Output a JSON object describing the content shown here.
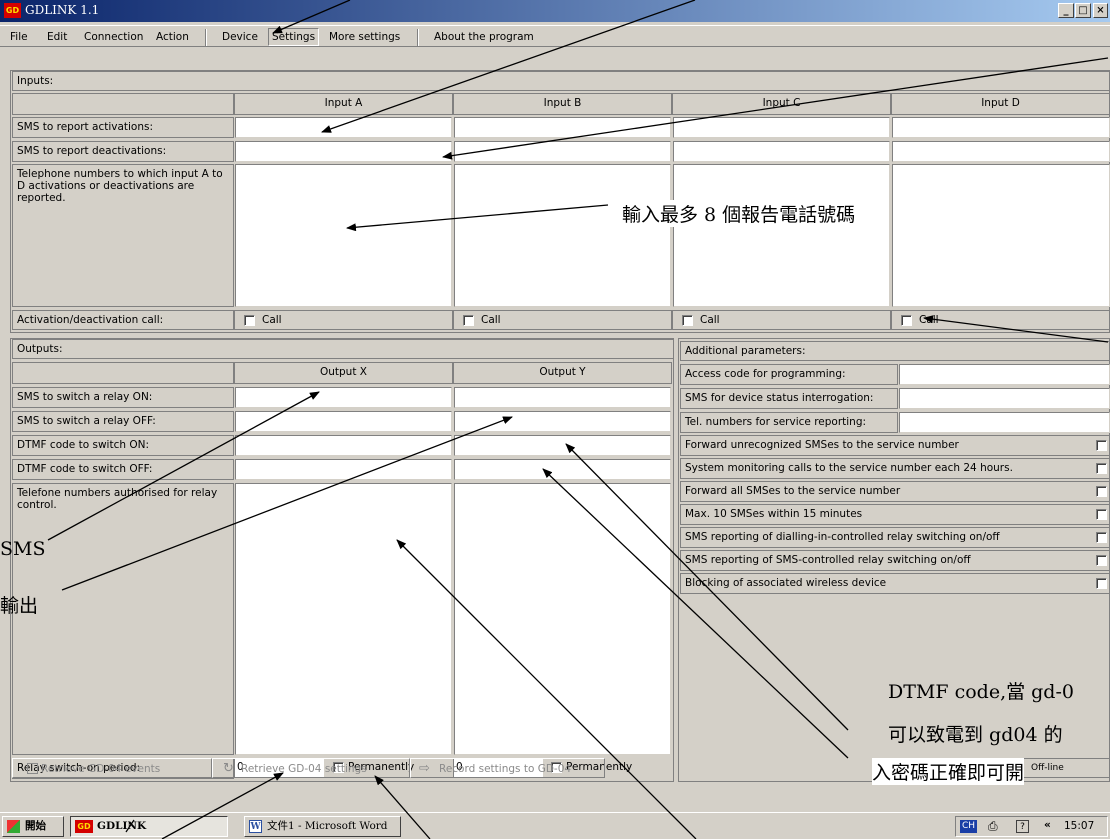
{
  "window": {
    "title": "GDLINK 1.1",
    "min": "_",
    "max": "□",
    "close": "×",
    "icon": "GD"
  },
  "menu": [
    "File",
    "Edit",
    "Connection",
    "Action",
    "Device",
    "Settings",
    "More settings",
    "About the program"
  ],
  "inputs": {
    "section_title": "Inputs:",
    "columns": [
      "Input A",
      "Input B",
      "Input C",
      "Input D"
    ],
    "rows": [
      "SMS to report activations:",
      "SMS to report deactivations:",
      "Telephone numbers to which input A to D activations or deactivations are reported.",
      "Activation/deactivation call:"
    ],
    "call_label": "Call"
  },
  "outputs": {
    "section_title": "Outputs:",
    "columns": [
      "Output X",
      "Output Y"
    ],
    "rows": [
      "SMS to switch a relay ON:",
      "SMS to switch a relay OFF:",
      "DTMF code to switch ON:",
      "DTMF code to switch OFF:",
      "Telefone numbers authorised for relay control.",
      "Relay switch-on period:"
    ],
    "period_x": "0",
    "period_y": "0",
    "permanently": "Permanently"
  },
  "additional": {
    "section_title": "Additional parameters:",
    "fields": [
      "Access code for programming:",
      "SMS for device status interrogation:",
      "Tel. numbers for service reporting:"
    ],
    "checks": [
      "Forward unrecognized SMSes to the service number",
      "System monitoring calls to the service number each 24 hours.",
      "Forward all SMSes to the service number",
      "Max. 10 SMSes within 15 minutes",
      "SMS reporting of dialling-in-controlled relay switching on/off",
      "SMS reporting of SMS-controlled relay switching on/off",
      "Blocking of associated wireless device"
    ]
  },
  "buttons": [
    "Retrieve GD-04 events",
    "Retrieve GD-04 settings",
    "Record settings to GD-04"
  ],
  "status": {
    "mode": "Off-line"
  },
  "taskbar": {
    "start": "開始",
    "items": [
      "GDLINK",
      "文件1 - Microsoft Word"
    ],
    "ime": "CH",
    "chevron": "«",
    "clock": "15:07"
  },
  "annotations": {
    "a1": "輸入最多 8 個報告電話號碼",
    "a2": "SMS",
    "a3": "輸出",
    "a4": "DTMF code,當 gd-0",
    "a5": "可以致電到 gd04 的",
    "a6": "入密碼正確即可開"
  },
  "colors": {
    "title_start": "#0a246a",
    "title_end": "#a6caf0",
    "face": "#d4d0c8",
    "icon": "#d40000"
  }
}
